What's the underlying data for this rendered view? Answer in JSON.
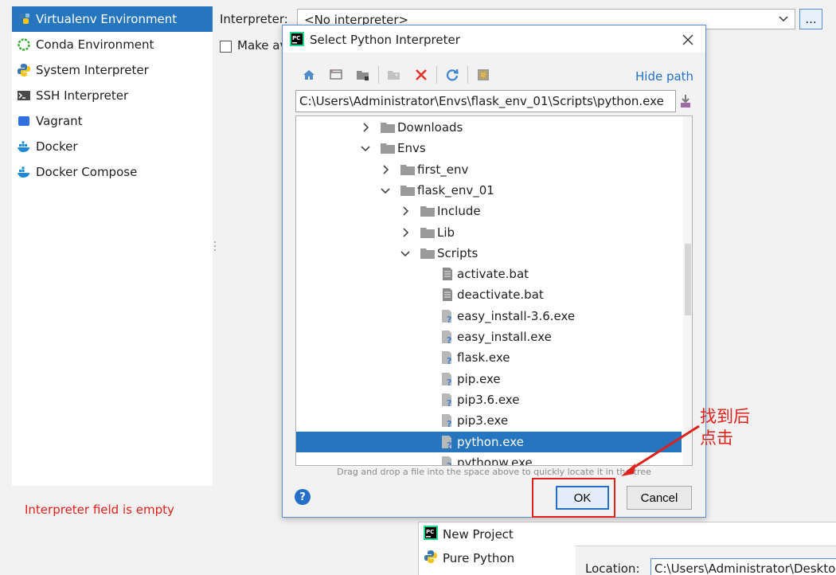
{
  "left_panel": {
    "items": [
      {
        "label": "Virtualenv Environment",
        "icon": "virtualenv-icon",
        "selected": true
      },
      {
        "label": "Conda Environment",
        "icon": "conda-icon"
      },
      {
        "label": "System Interpreter",
        "icon": "python-icon"
      },
      {
        "label": "SSH Interpreter",
        "icon": "terminal-icon"
      },
      {
        "label": "Vagrant",
        "icon": "vagrant-icon"
      },
      {
        "label": "Docker",
        "icon": "docker-icon"
      },
      {
        "label": "Docker Compose",
        "icon": "docker-compose-icon"
      }
    ],
    "error": "Interpreter field is empty"
  },
  "interpreter": {
    "label": "Interpreter:",
    "value": "<No interpreter>",
    "browse_label": "..."
  },
  "make_available": {
    "label": "Make available to all projects"
  },
  "dialog": {
    "title": "Select Python Interpreter",
    "hide_path": "Hide path",
    "path": "C:\\Users\\Administrator\\Envs\\flask_env_01\\Scripts\\python.exe",
    "tree": [
      {
        "label": "Downloads",
        "type": "folder",
        "expanded": false
      },
      {
        "label": "Envs",
        "type": "folder",
        "expanded": true
      },
      {
        "label": "first_env",
        "type": "folder",
        "expanded": false
      },
      {
        "label": "flask_env_01",
        "type": "folder",
        "expanded": true
      },
      {
        "label": "Include",
        "type": "folder",
        "expanded": false
      },
      {
        "label": "Lib",
        "type": "folder",
        "expanded": false
      },
      {
        "label": "Scripts",
        "type": "folder",
        "expanded": true
      },
      {
        "label": "activate.bat",
        "type": "text-file"
      },
      {
        "label": "deactivate.bat",
        "type": "text-file"
      },
      {
        "label": "easy_install-3.6.exe",
        "type": "unknown-file"
      },
      {
        "label": "easy_install.exe",
        "type": "unknown-file"
      },
      {
        "label": "flask.exe",
        "type": "unknown-file"
      },
      {
        "label": "pip.exe",
        "type": "unknown-file"
      },
      {
        "label": "pip3.6.exe",
        "type": "unknown-file"
      },
      {
        "label": "pip3.exe",
        "type": "unknown-file"
      },
      {
        "label": "python.exe",
        "type": "unknown-file",
        "selected": true
      },
      {
        "label": "pythonw.exe",
        "type": "unknown-file"
      }
    ],
    "hint": "Drag and drop a file into the space above to quickly locate it in the tree",
    "help_label": "?",
    "ok_label": "OK",
    "cancel_label": "Cancel"
  },
  "annotation": {
    "text": "找到后点击",
    "color": "#e0201a"
  },
  "background_window": {
    "items": [
      {
        "label": "New Project",
        "icon": "pycharm-icon"
      },
      {
        "label": "Pure Python",
        "icon": "python-icon"
      }
    ],
    "location_label": "Location:",
    "location_value": "C:\\Users\\Administrator\\Desktop"
  },
  "colors": {
    "accent": "#2675bf",
    "link": "#2470c8",
    "error": "#e0201a"
  }
}
